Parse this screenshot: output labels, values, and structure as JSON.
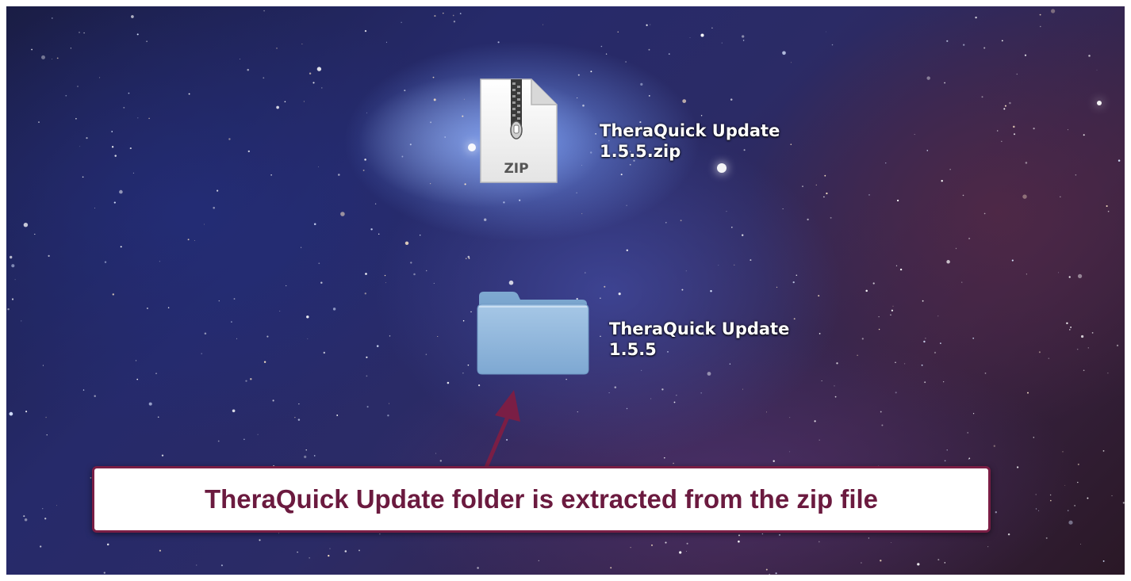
{
  "desktop": {
    "icons": [
      {
        "type": "zip-file",
        "badge": "ZIP",
        "label_line1": "TheraQuick Update",
        "label_line2": "1.5.5.zip"
      },
      {
        "type": "folder",
        "label_line1": "TheraQuick Update",
        "label_line2": "1.5.5"
      }
    ]
  },
  "callout": {
    "text": "TheraQuick Update folder is extracted from the zip file"
  },
  "colors": {
    "callout_border": "#7a1e45",
    "callout_text": "#6b1a3f",
    "arrow": "#7a1e45",
    "folder": "#8fb4d8"
  }
}
